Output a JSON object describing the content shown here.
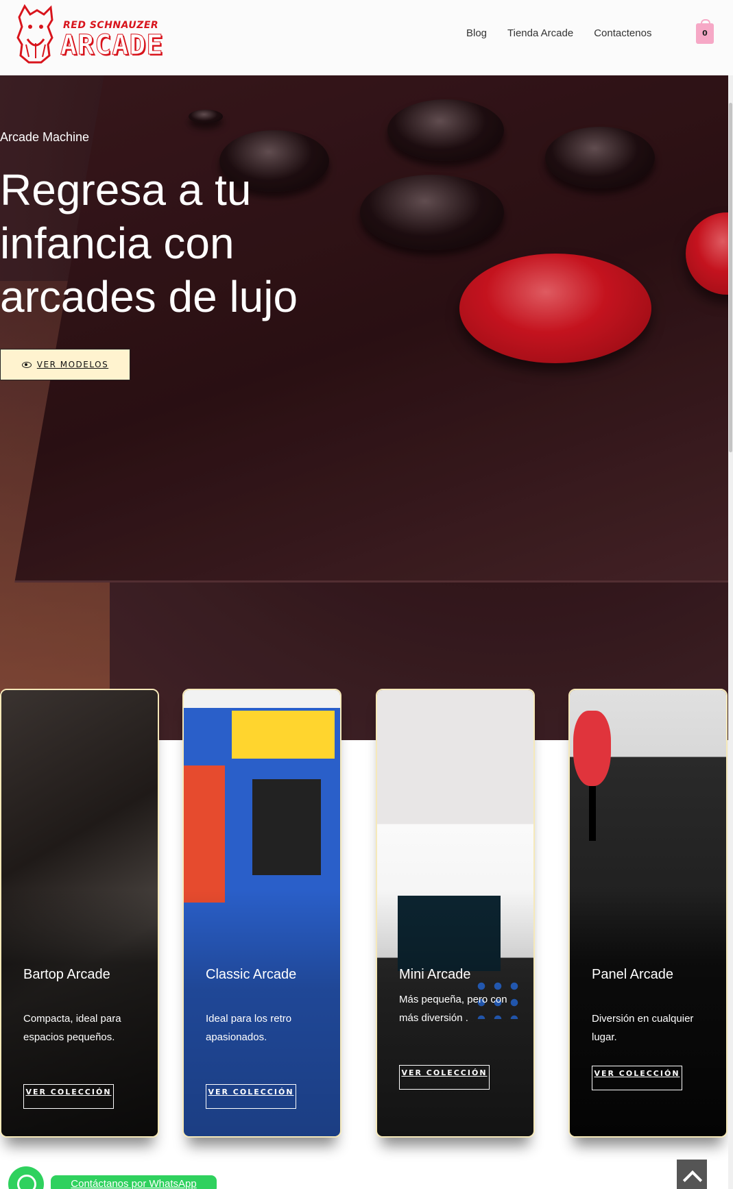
{
  "brand": {
    "line1": "RED SCHNAUZER",
    "line2": "ARCADE"
  },
  "nav": {
    "items": [
      "Blog",
      "Tienda Arcade",
      "Contactenos"
    ]
  },
  "cart": {
    "count": "0"
  },
  "hero": {
    "subtitle": "Arcade Machine",
    "title": "Regresa a tu infancia con arcades de lujo",
    "button": "VER MODELOS"
  },
  "cards": [
    {
      "title": "Bartop Arcade",
      "desc": "Compacta, ideal para espacios pequeños.",
      "button": "VER COLECCIÓN"
    },
    {
      "title": "Classic Arcade",
      "desc": "Ideal para los retro apasionados.",
      "button": "VER COLECCIÓN"
    },
    {
      "title": "Mini Arcade",
      "desc": "Más pequeña, pero con más diversión .",
      "button": "VER COLECCIÓN"
    },
    {
      "title": "Panel Arcade",
      "desc": "Diversión en cualquier lugar.",
      "button": "VER COLECCIÓN"
    }
  ],
  "whatsapp": {
    "label": "Contáctanos por WhatsApp"
  },
  "colors": {
    "brand_red": "#d8141c",
    "cream": "#fff3cf",
    "whatsapp": "#2fd15e",
    "cart_pink": "#f6a8c6"
  }
}
